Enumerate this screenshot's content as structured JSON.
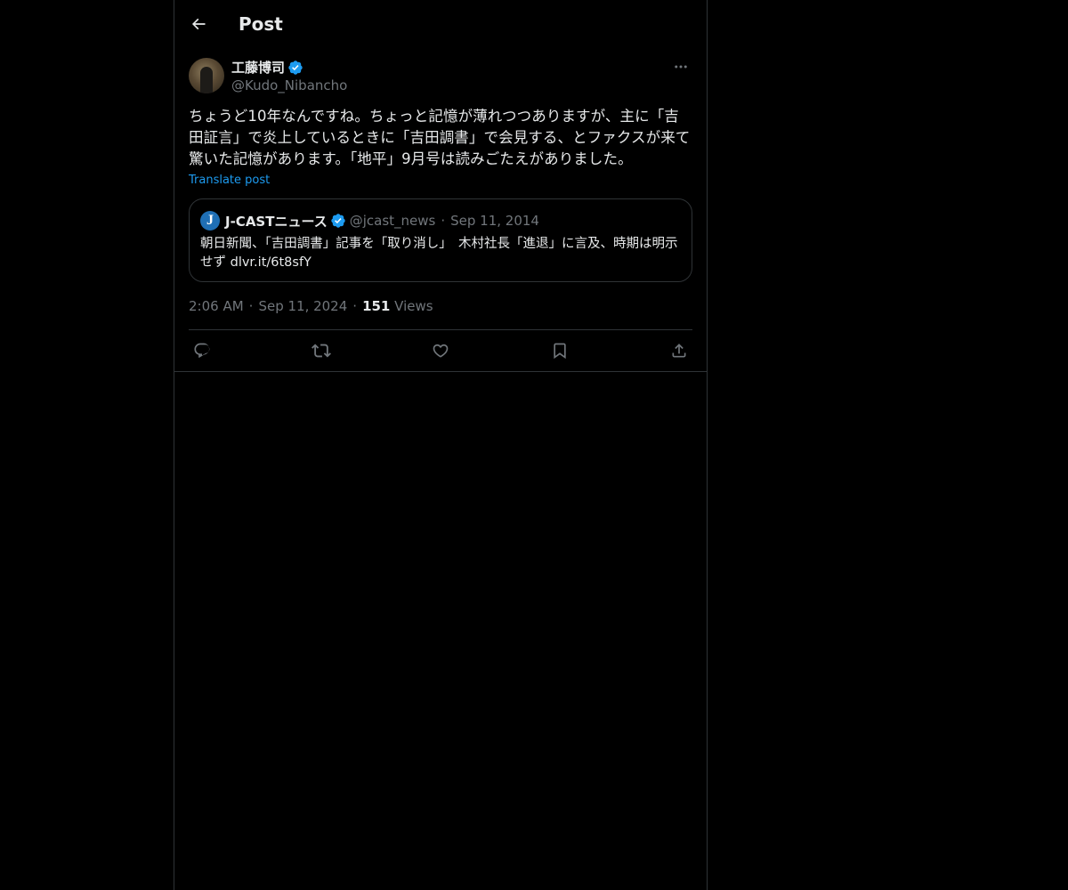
{
  "header": {
    "title": "Post"
  },
  "post": {
    "author": {
      "display_name": "工藤博司",
      "handle": "@Kudo_Nibancho"
    },
    "text": "ちょうど10年なんですね。ちょっと記憶が薄れつつありますが、主に「吉田証言」で炎上しているときに「吉田調書」で会見する、とファクスが来て驚いた記憶があります。「地平」9月号は読みごたえがありました。",
    "translate_label": "Translate post",
    "quote": {
      "avatar_letter": "J",
      "display_name": "J-CASTニュース",
      "handle": "@jcast_news",
      "separator": "·",
      "date": "Sep 11, 2014",
      "text": "朝日新聞、「吉田調書」記事を「取り消し」　木村社長「進退」に言及、時期は明示せず dlvr.it/6t8sfY"
    },
    "meta": {
      "time": "2:06 AM",
      "date": "Sep 11, 2024",
      "separator": "·",
      "views_count": "151",
      "views_label": "Views"
    }
  },
  "actions": [
    {
      "name": "reply",
      "icon": "reply-icon"
    },
    {
      "name": "repost",
      "icon": "repost-icon"
    },
    {
      "name": "like",
      "icon": "like-icon"
    },
    {
      "name": "bookmark",
      "icon": "bookmark-icon"
    },
    {
      "name": "share",
      "icon": "share-icon"
    }
  ],
  "colors": {
    "background": "#000000",
    "text": "#e7e9ea",
    "muted": "#71767b",
    "accent": "#1d9bf0",
    "border": "#2f3336"
  }
}
